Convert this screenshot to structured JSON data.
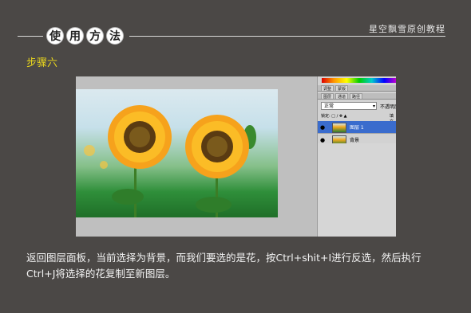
{
  "header": {
    "method_chars": [
      "使",
      "用",
      "方",
      "法"
    ],
    "brand": "星空飘雪原创教程"
  },
  "step_title": "步骤六",
  "layers_panel": {
    "tabs": [
      "图层",
      "通道",
      "路径"
    ],
    "top_tabs": [
      "调整",
      "蒙版"
    ],
    "blend_mode": "正常",
    "opacity_label": "不透明度",
    "lock_label": "锁定:",
    "fill_label": "填充",
    "layers": [
      {
        "name": "图层 1",
        "selected": true
      },
      {
        "name": "背景",
        "selected": false
      }
    ]
  },
  "description": "返回图层面板，当前选择为背景，而我们要选的是花，按Ctrl+shit+I进行反选，然后执行Ctrl+J将选择的花复制至新图层。",
  "colors": {
    "background": "#4b4846",
    "step_accent": "#e8d51e",
    "selected_layer": "#3a6ccd"
  }
}
